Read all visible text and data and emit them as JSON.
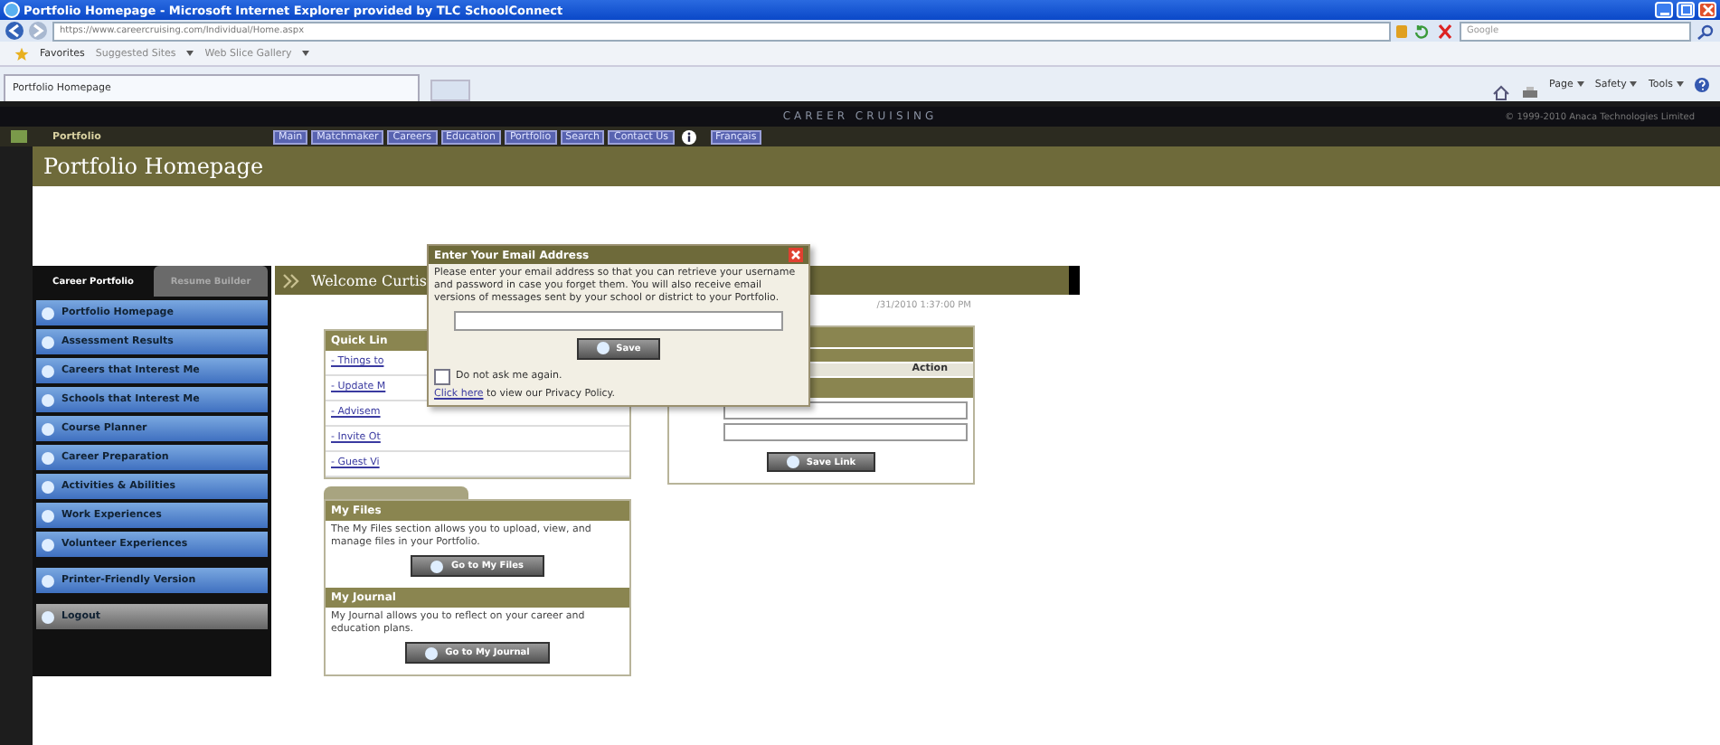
{
  "window": {
    "title": "Portfolio Homepage - Microsoft Internet Explorer provided by TLC SchoolConnect"
  },
  "address_bar": {
    "url": "https://www.careercruising.com/Individual/Home.aspx"
  },
  "search": {
    "placeholder": "Google"
  },
  "favorites_bar": {
    "label": "Favorites",
    "links": [
      "Suggested Sites",
      "Web Slice Gallery"
    ]
  },
  "browser_tabs": [
    {
      "label": "Portfolio Homepage",
      "selected": true
    }
  ],
  "command_bar": [
    "Page",
    "Safety",
    "Tools"
  ],
  "site": {
    "brand": "CAREER CRUISING",
    "copyright": "© 1999-2010 Anaca Technologies Limited",
    "section": "Portfolio",
    "nav": [
      "Main",
      "Matchmaker",
      "Careers",
      "Education",
      "Portfolio",
      "Search",
      "Contact Us"
    ],
    "language": "Français"
  },
  "page_title": "Portfolio Homepage",
  "sidebar": {
    "tabs": [
      {
        "label": "Career Portfolio",
        "selected": true
      },
      {
        "label": "Resume Builder",
        "selected": false
      }
    ],
    "items": [
      {
        "label": "Portfolio Homepage",
        "kind": "page"
      },
      {
        "label": "Assessment Results",
        "kind": "page"
      },
      {
        "label": "Careers that Interest Me",
        "kind": "page"
      },
      {
        "label": "Schools that Interest Me",
        "kind": "page"
      },
      {
        "label": "Course Planner",
        "kind": "page"
      },
      {
        "label": "Career Preparation",
        "kind": "page"
      },
      {
        "label": "Activities & Abilities",
        "kind": "page"
      },
      {
        "label": "Work Experiences",
        "kind": "page"
      },
      {
        "label": "Volunteer Experiences",
        "kind": "page"
      },
      {
        "label": "Printer-Friendly Version",
        "kind": "print"
      },
      {
        "label": "Logout",
        "kind": "logout"
      }
    ]
  },
  "welcome": {
    "heading": "Welcome Curtis",
    "date": "/31/2010 1:37:00 PM"
  },
  "quick_links": {
    "title": "Quick Lin",
    "links": [
      "- Things to",
      "- Update M",
      "- Advisem",
      "- Invite Ot",
      "- Guest Vi"
    ]
  },
  "links_panel": {
    "column": "Action",
    "button": "Save Link"
  },
  "my_files": {
    "title": "My Files",
    "text": "The My Files section allows you to upload, view, and manage files in your Portfolio.",
    "button": "Go to My Files"
  },
  "my_journal": {
    "title": "My Journal",
    "text": "My Journal allows you to reflect on your career and education plans.",
    "button": "Go to My Journal"
  },
  "dialog": {
    "title": "Enter Your Email Address",
    "message": "Please enter your email address so that you can retrieve your username and password in case you forget them. You will also receive email versions of messages sent by your school or district to your Portfolio.",
    "button": "Save",
    "dont_ask": {
      "label": "Do not ask me again.",
      "checked": false
    },
    "privacy_link": "Click here",
    "privacy_text": " to view our Privacy Policy."
  }
}
